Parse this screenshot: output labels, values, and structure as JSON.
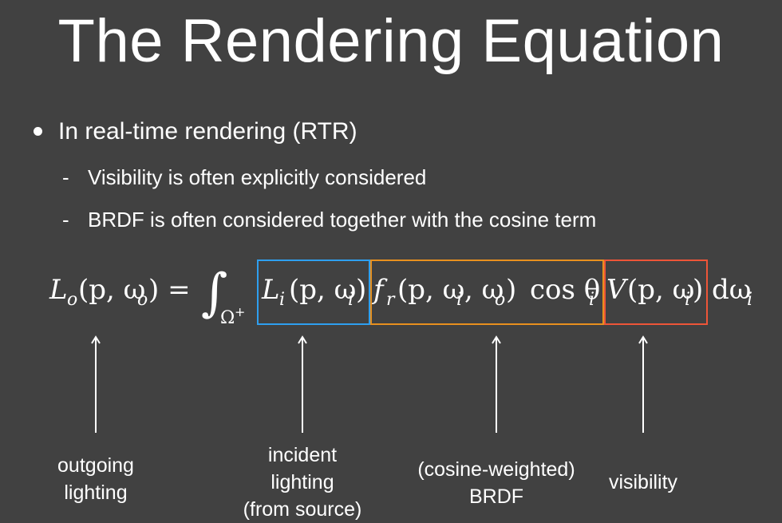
{
  "slide": {
    "title": "The Rendering Equation",
    "bullet": "In real-time rendering (RTR)",
    "sub_bullets": [
      {
        "dash": "-",
        "text": "Visibility is often explicitly considered"
      },
      {
        "dash": "-",
        "text": "BRDF is often considered together with the cosine term"
      }
    ]
  },
  "equation": {
    "lhs": "L",
    "lhs_sub": "o",
    "lhs_args": "(p, ω",
    "lhs_args_sub": "o",
    "lhs_close": ") =",
    "integral": "∫",
    "domain": "Ω",
    "domain_sup": "+",
    "incident": "L",
    "incident_sub": "i",
    "incident_args": "(p, ω",
    "incident_args_sub": "i",
    "incident_close": ")",
    "brdf": "f",
    "brdf_sub": "r",
    "brdf_args": "(p, ω",
    "brdf_args_sub1": "i",
    "brdf_mid": ", ω",
    "brdf_args_sub2": "o",
    "brdf_close": ")",
    "cos": "cos θ",
    "cos_sub": "i",
    "vis": "V",
    "vis_args": "(p, ω",
    "vis_args_sub": "i",
    "vis_close": ")",
    "dw": "dω",
    "dw_sub": "i"
  },
  "colors": {
    "background": "#414141",
    "incident_box": "#2e9ff0",
    "brdf_box": "#e8901e",
    "visibility_box": "#ee5538",
    "text": "#ffffff"
  },
  "annotations": [
    {
      "line1": "outgoing",
      "line2": "lighting",
      "line3": ""
    },
    {
      "line1": "incident",
      "line2": "lighting",
      "line3": "(from source)"
    },
    {
      "line1": "(cosine-weighted)",
      "line2": "BRDF",
      "line3": ""
    },
    {
      "line1": "visibility",
      "line2": "",
      "line3": ""
    }
  ]
}
